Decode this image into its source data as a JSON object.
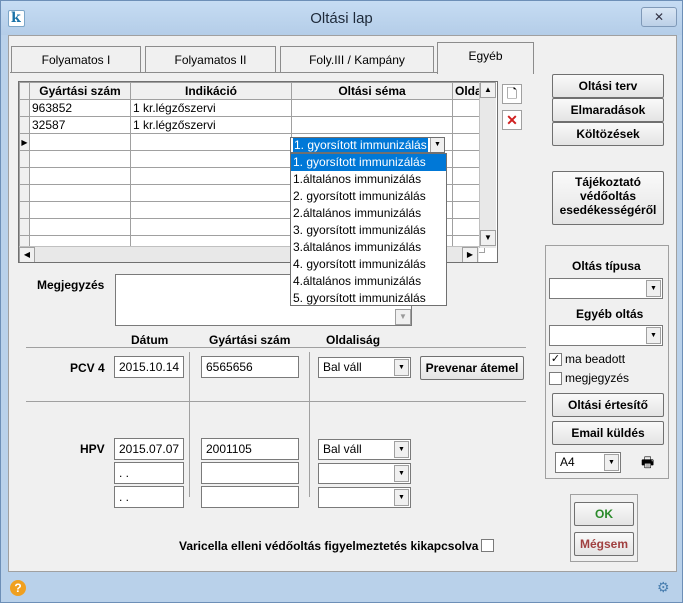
{
  "window": {
    "title": "Oltási lap",
    "close_glyph": "✕",
    "app_icon_glyph": "k"
  },
  "tabs": [
    {
      "label": "Folyamatos I"
    },
    {
      "label": "Folyamatos II"
    },
    {
      "label": "Foly.III / Kampány"
    },
    {
      "label": "Egyéb"
    }
  ],
  "grid": {
    "columns": [
      "Gyártási szám",
      "Indikáció",
      "Oltási séma",
      "Olda"
    ],
    "rows": [
      {
        "serial": "963852",
        "indication": "1 kr.légzőszervi",
        "schema": ""
      },
      {
        "serial": "32587",
        "indication": "1 kr.légzőszervi",
        "schema": ""
      }
    ],
    "editor_value": "1. gyorsított immunizálás",
    "options": [
      "1. gyorsított immunizálás",
      "1.általános immunizálás",
      "2. gyorsított immunizálás",
      "2.általános immunizálás",
      "3. gyorsított immunizálás",
      "3.általános immunizálás",
      "4. gyorsított immunizálás",
      "4.általános immunizálás",
      "5. gyorsított immunizálás"
    ]
  },
  "note": {
    "label": "Megjegyzés"
  },
  "vaccines": {
    "headers": {
      "date": "Dátum",
      "serial": "Gyártási szám",
      "side": "Oldaliság"
    },
    "pcv": {
      "label": "PCV 4",
      "date": "2015.10.14",
      "serial": "6565656",
      "side": "Bal váll",
      "button": "Prevenar átemel"
    },
    "hpv": {
      "label": "HPV",
      "rows": [
        {
          "date": "2015.07.07",
          "serial": "2001105",
          "side": "Bal váll"
        },
        {
          "date": " .  .",
          "serial": "",
          "side": ""
        },
        {
          "date": " .  .",
          "serial": "",
          "side": ""
        }
      ]
    },
    "varicella_label": "Varicella elleni védőoltás figyelmeztetés kikapcsolva"
  },
  "right": {
    "buttons": [
      "Oltási terv",
      "Elmaradások",
      "Költözések"
    ],
    "info_button": [
      "Tájékoztató",
      "védőoltás",
      "esedékességéről"
    ],
    "type_label": "Oltás típusa",
    "other_label": "Egyéb oltás",
    "cb_given": "ma beadott",
    "cb_note": "megjegyzés",
    "notice_button": "Oltási értesítő",
    "email_button": "Email küldés",
    "paper": "A4",
    "ok": "OK",
    "cancel": "Mégsem"
  },
  "status": {
    "help_glyph": "?",
    "net_glyph": "⚙"
  },
  "colors": {
    "accent": "#0078d7",
    "ok": "#2a8a2a",
    "cancel": "#a04040"
  }
}
